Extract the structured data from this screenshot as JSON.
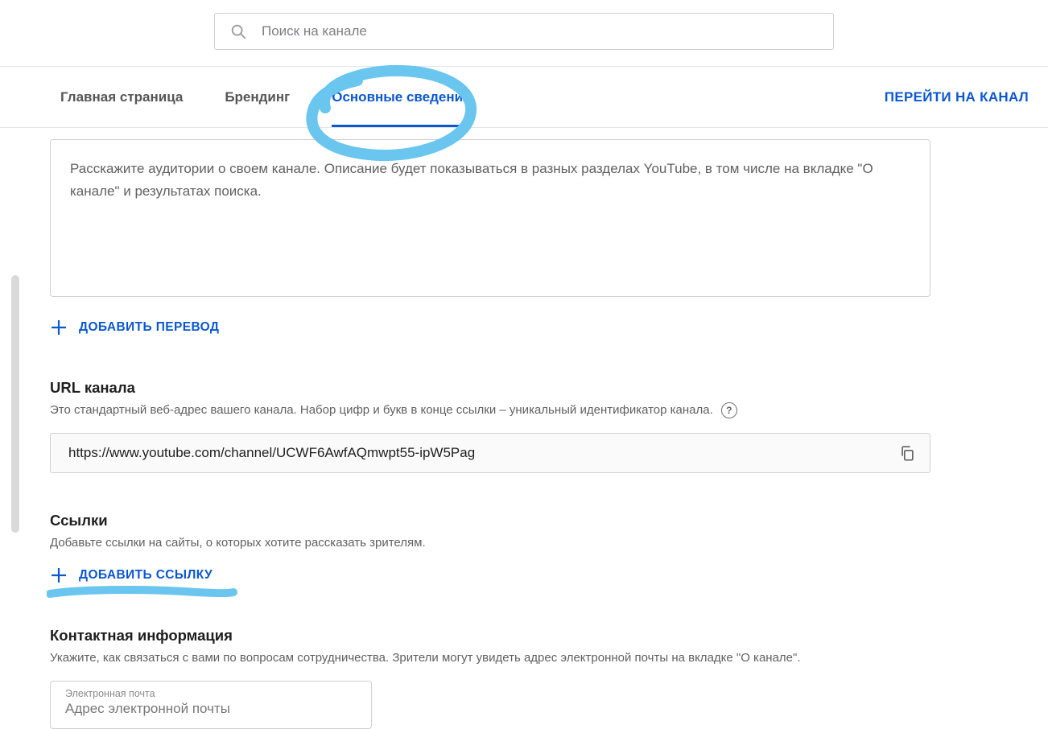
{
  "search": {
    "placeholder": "Поиск на канале"
  },
  "tabs": {
    "home": "Главная страница",
    "branding": "Брендинг",
    "basic": "Основные сведения"
  },
  "channel_link": "ПЕРЕЙТИ НА КАНАЛ",
  "description": {
    "placeholder": "Расскажите аудитории о своем канале. Описание будет показываться в разных разделах YouTube, в том числе на вкладке \"О канале\" и результатах поиска."
  },
  "add_translation_label": "ДОБАВИТЬ ПЕРЕВОД",
  "url_section": {
    "title": "URL канала",
    "subtitle": "Это стандартный веб-адрес вашего канала. Набор цифр и букв в конце ссылки – уникальный идентификатор канала.",
    "value": "https://www.youtube.com/channel/UCWF6AwfAQmwpt55-ipW5Pag"
  },
  "links_section": {
    "title": "Ссылки",
    "subtitle": "Добавьте ссылки на сайты, о которых хотите рассказать зрителям.",
    "add_label": "ДОБАВИТЬ ССЫЛКУ"
  },
  "contact_section": {
    "title": "Контактная информация",
    "subtitle": "Укажите, как связаться с вами по вопросам сотрудничества. Зрители могут увидеть адрес электронной почты на вкладке \"О канале\".",
    "float_label": "Электронная почта",
    "placeholder": "Адрес электронной почты"
  },
  "annotation": {
    "circle_color": "#6ac6ee",
    "underline_color": "#6ac6ee"
  }
}
